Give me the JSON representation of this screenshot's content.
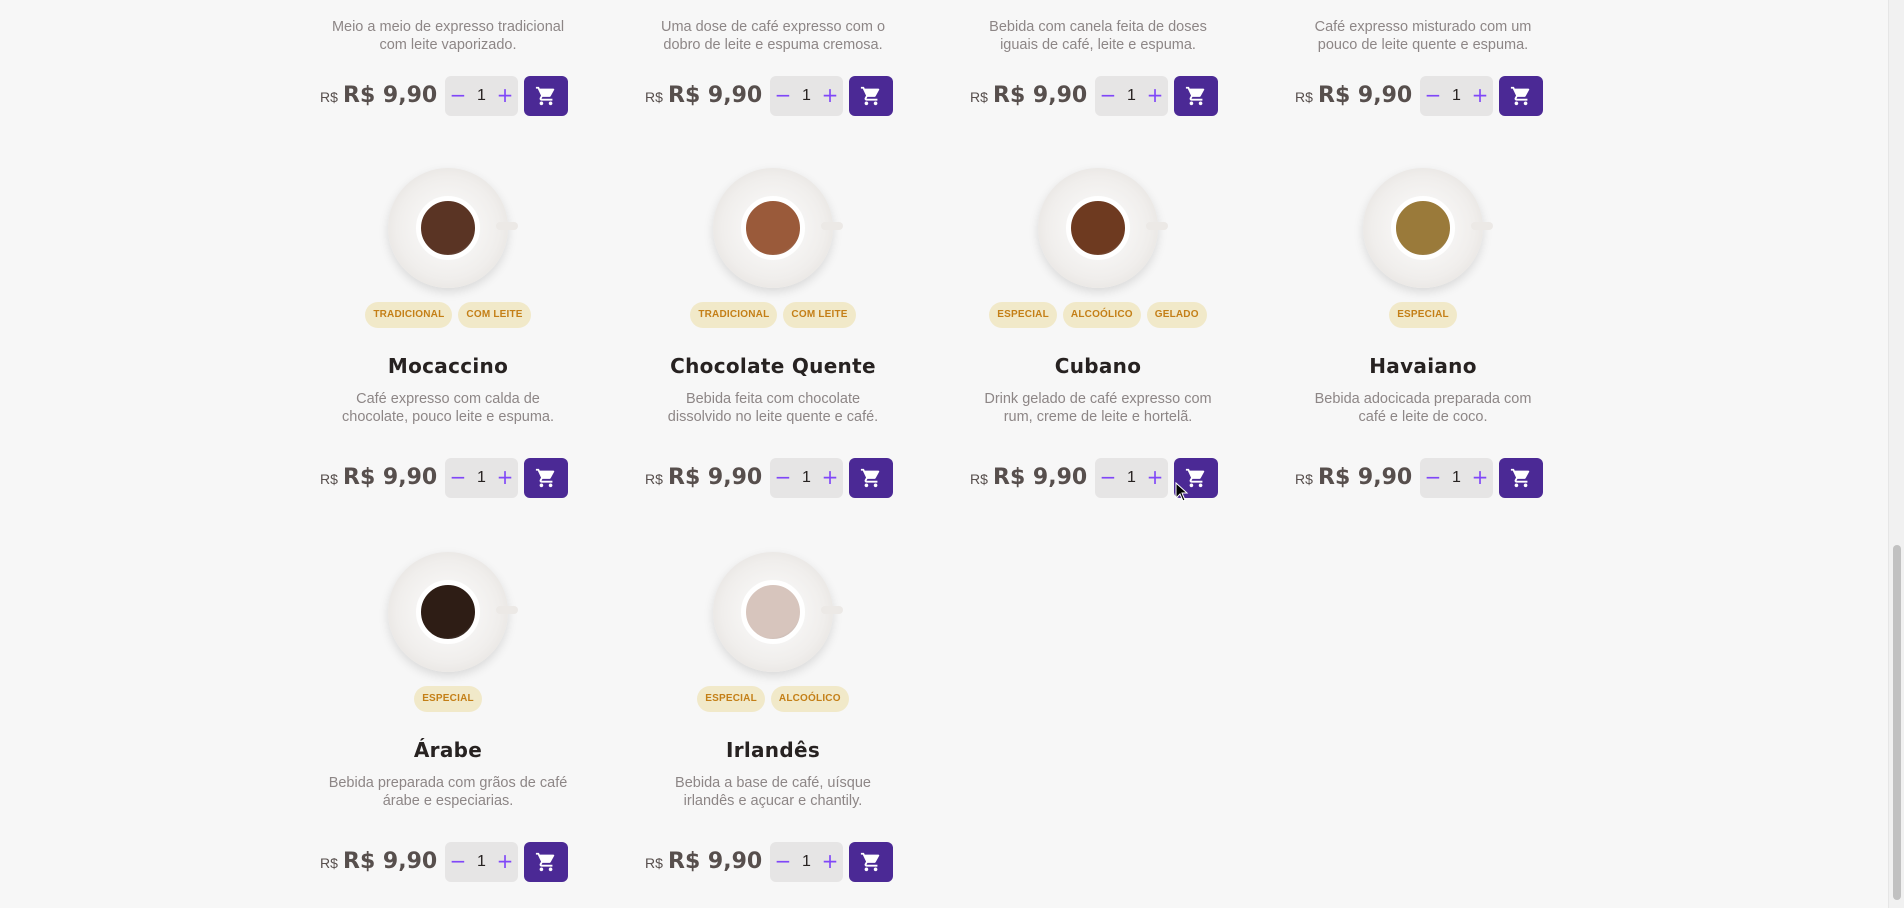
{
  "currency_label": "R$",
  "minus_symbol": "−",
  "plus_symbol": "+",
  "top_row": [
    {
      "description": "Meio a meio de expresso tradicional com leite vaporizado.",
      "price": "R$ 9,90",
      "quantity": "1"
    },
    {
      "description": "Uma dose de café expresso com o dobro de leite e espuma cremosa.",
      "price": "R$ 9,90",
      "quantity": "1"
    },
    {
      "description": "Bebida com canela feita de doses iguais de café, leite e espuma.",
      "price": "R$ 9,90",
      "quantity": "1"
    },
    {
      "description": "Café expresso misturado com um pouco de leite quente e espuma.",
      "price": "R$ 9,90",
      "quantity": "1"
    }
  ],
  "products": [
    {
      "name": "Mocaccino",
      "tags": [
        "TRADICIONAL",
        "COM LEITE"
      ],
      "description": "Café expresso com calda de chocolate, pouco leite e espuma.",
      "price": "R$ 9,90",
      "quantity": "1",
      "image": "mocaccino-cup-image",
      "coffee_color": "#5a3424"
    },
    {
      "name": "Chocolate Quente",
      "tags": [
        "TRADICIONAL",
        "COM LEITE"
      ],
      "description": "Bebida feita com chocolate dissolvido no leite quente e café.",
      "price": "R$ 9,90",
      "quantity": "1",
      "image": "hot-chocolate-cup-image",
      "coffee_color": "#9a5a3a"
    },
    {
      "name": "Cubano",
      "tags": [
        "ESPECIAL",
        "ALCOÓLICO",
        "GELADO"
      ],
      "description": "Drink gelado de café expresso com rum, creme de leite e hortelã.",
      "price": "R$ 9,90",
      "quantity": "1",
      "image": "cubano-cup-image",
      "coffee_color": "#6e3a20"
    },
    {
      "name": "Havaiano",
      "tags": [
        "ESPECIAL"
      ],
      "description": "Bebida adocicada preparada com café e leite de coco.",
      "price": "R$ 9,90",
      "quantity": "1",
      "image": "havaiano-cup-image",
      "coffee_color": "#9a7a3a"
    },
    {
      "name": "Árabe",
      "tags": [
        "ESPECIAL"
      ],
      "description": "Bebida preparada com grãos de café árabe e especiarias.",
      "price": "R$ 9,90",
      "quantity": "1",
      "image": "arabe-cup-image",
      "coffee_color": "#2e1d15"
    },
    {
      "name": "Irlandês",
      "tags": [
        "ESPECIAL",
        "ALCOÓLICO"
      ],
      "description": "Bebida a base de café, uísque irlandês e açucar e chantily.",
      "price": "R$ 9,90",
      "quantity": "1",
      "image": "irlandes-cup-image",
      "coffee_color": "#d7c5bd"
    }
  ],
  "colors": {
    "purple": "#4b2995",
    "purple_light": "#8047f8",
    "tag_bg": "#f1e9c9",
    "tag_text": "#c47f17"
  }
}
